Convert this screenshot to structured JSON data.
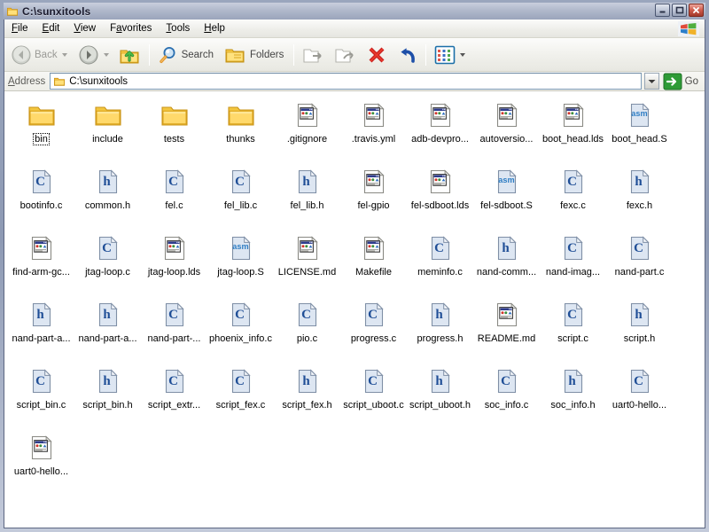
{
  "window": {
    "title": "C:\\sunxitools",
    "title_icon": "folder-icon",
    "buttons": {
      "minimize": "minimize-button",
      "maximize": "maximize-button",
      "close": "close-button"
    }
  },
  "menubar": {
    "items": [
      {
        "label": "File",
        "accel": "F"
      },
      {
        "label": "Edit",
        "accel": "E"
      },
      {
        "label": "View",
        "accel": "V"
      },
      {
        "label": "Favorites",
        "accel": "a"
      },
      {
        "label": "Tools",
        "accel": "T"
      },
      {
        "label": "Help",
        "accel": "H"
      }
    ],
    "brand_icon": "windows-flag-icon"
  },
  "toolbar": {
    "back_label": "Back",
    "forward_label": "",
    "up_label": "",
    "search_label": "Search",
    "folders_label": "Folders",
    "moveto_label": "",
    "copyto_label": "",
    "delete_label": "",
    "undo_label": "",
    "views_label": "",
    "icons": [
      "back-icon",
      "forward-icon",
      "up-folder-icon",
      "search-icon",
      "folders-icon",
      "move-to-icon",
      "copy-to-icon",
      "delete-icon",
      "undo-icon",
      "views-icon"
    ]
  },
  "address": {
    "label": "Address",
    "value": "C:\\sunxitools",
    "placeholder": "C:\\sunxitools",
    "folder_icon": "folder-icon",
    "dropdown_icon": "chevron-down-icon",
    "go_label": "Go",
    "go_icon": "go-arrow-icon"
  },
  "colors": {
    "folder_yellow": "#ffd96b",
    "folder_edge": "#d9a21b",
    "code_page": "#dde6f2",
    "code_letter": "#1f4e96",
    "asm_letter": "#2f7ec4",
    "delete_red": "#d02020",
    "undo_blue": "#1d4fa8",
    "go_green": "#2e9b36",
    "titlebar": "#9aa4bb",
    "pane_bg": "#ffffff"
  },
  "files": [
    {
      "name": "bin",
      "type": "folder",
      "icon": "folder-icon",
      "focused": true
    },
    {
      "name": "include",
      "type": "folder",
      "icon": "folder-icon",
      "focused": false
    },
    {
      "name": "tests",
      "type": "folder",
      "icon": "folder-icon",
      "focused": false
    },
    {
      "name": "thunks",
      "type": "folder",
      "icon": "folder-icon",
      "focused": false
    },
    {
      "name": ".gitignore",
      "type": "generic",
      "icon": "unknown-file-icon",
      "focused": false
    },
    {
      "name": ".travis.yml",
      "type": "generic",
      "icon": "unknown-file-icon",
      "focused": false
    },
    {
      "name": "adb-devpro...",
      "type": "generic",
      "icon": "unknown-file-icon",
      "focused": false
    },
    {
      "name": "autoversio...",
      "type": "generic",
      "icon": "unknown-file-icon",
      "focused": false
    },
    {
      "name": "boot_head.lds",
      "type": "generic",
      "icon": "unknown-file-icon",
      "focused": false
    },
    {
      "name": "boot_head.S",
      "type": "asm",
      "icon": "asm-file-icon",
      "focused": false
    },
    {
      "name": "bootinfo.c",
      "type": "c",
      "icon": "c-file-icon",
      "focused": false
    },
    {
      "name": "common.h",
      "type": "h",
      "icon": "h-file-icon",
      "focused": false
    },
    {
      "name": "fel.c",
      "type": "c",
      "icon": "c-file-icon",
      "focused": false
    },
    {
      "name": "fel_lib.c",
      "type": "c",
      "icon": "c-file-icon",
      "focused": false
    },
    {
      "name": "fel_lib.h",
      "type": "h",
      "icon": "h-file-icon",
      "focused": false
    },
    {
      "name": "fel-gpio",
      "type": "generic",
      "icon": "unknown-file-icon",
      "focused": false
    },
    {
      "name": "fel-sdboot.lds",
      "type": "generic",
      "icon": "unknown-file-icon",
      "focused": false
    },
    {
      "name": "fel-sdboot.S",
      "type": "asm",
      "icon": "asm-file-icon",
      "focused": false
    },
    {
      "name": "fexc.c",
      "type": "c",
      "icon": "c-file-icon",
      "focused": false
    },
    {
      "name": "fexc.h",
      "type": "h",
      "icon": "h-file-icon",
      "focused": false
    },
    {
      "name": "find-arm-gc...",
      "type": "generic",
      "icon": "unknown-file-icon",
      "focused": false
    },
    {
      "name": "jtag-loop.c",
      "type": "c",
      "icon": "c-file-icon",
      "focused": false
    },
    {
      "name": "jtag-loop.lds",
      "type": "generic",
      "icon": "unknown-file-icon",
      "focused": false
    },
    {
      "name": "jtag-loop.S",
      "type": "asm",
      "icon": "asm-file-icon",
      "focused": false
    },
    {
      "name": "LICENSE.md",
      "type": "generic",
      "icon": "unknown-file-icon",
      "focused": false
    },
    {
      "name": "Makefile",
      "type": "generic",
      "icon": "unknown-file-icon",
      "focused": false
    },
    {
      "name": "meminfo.c",
      "type": "c",
      "icon": "c-file-icon",
      "focused": false
    },
    {
      "name": "nand-comm...",
      "type": "h",
      "icon": "h-file-icon",
      "focused": false
    },
    {
      "name": "nand-imag...",
      "type": "c",
      "icon": "c-file-icon",
      "focused": false
    },
    {
      "name": "nand-part.c",
      "type": "c",
      "icon": "c-file-icon",
      "focused": false
    },
    {
      "name": "nand-part-a...",
      "type": "h",
      "icon": "h-file-icon",
      "focused": false
    },
    {
      "name": "nand-part-a...",
      "type": "h",
      "icon": "h-file-icon",
      "focused": false
    },
    {
      "name": "nand-part-...",
      "type": "c",
      "icon": "c-file-icon",
      "focused": false
    },
    {
      "name": "phoenix_info.c",
      "type": "c",
      "icon": "c-file-icon",
      "focused": false
    },
    {
      "name": "pio.c",
      "type": "c",
      "icon": "c-file-icon",
      "focused": false
    },
    {
      "name": "progress.c",
      "type": "c",
      "icon": "c-file-icon",
      "focused": false
    },
    {
      "name": "progress.h",
      "type": "h",
      "icon": "h-file-icon",
      "focused": false
    },
    {
      "name": "README.md",
      "type": "generic",
      "icon": "unknown-file-icon",
      "focused": false
    },
    {
      "name": "script.c",
      "type": "c",
      "icon": "c-file-icon",
      "focused": false
    },
    {
      "name": "script.h",
      "type": "h",
      "icon": "h-file-icon",
      "focused": false
    },
    {
      "name": "script_bin.c",
      "type": "c",
      "icon": "c-file-icon",
      "focused": false
    },
    {
      "name": "script_bin.h",
      "type": "h",
      "icon": "h-file-icon",
      "focused": false
    },
    {
      "name": "script_extr...",
      "type": "c",
      "icon": "c-file-icon",
      "focused": false
    },
    {
      "name": "script_fex.c",
      "type": "c",
      "icon": "c-file-icon",
      "focused": false
    },
    {
      "name": "script_fex.h",
      "type": "h",
      "icon": "h-file-icon",
      "focused": false
    },
    {
      "name": "script_uboot.c",
      "type": "c",
      "icon": "c-file-icon",
      "focused": false
    },
    {
      "name": "script_uboot.h",
      "type": "h",
      "icon": "h-file-icon",
      "focused": false
    },
    {
      "name": "soc_info.c",
      "type": "c",
      "icon": "c-file-icon",
      "focused": false
    },
    {
      "name": "soc_info.h",
      "type": "h",
      "icon": "h-file-icon",
      "focused": false
    },
    {
      "name": "uart0-hello...",
      "type": "c",
      "icon": "c-file-icon",
      "focused": false
    },
    {
      "name": "uart0-hello...",
      "type": "generic",
      "icon": "unknown-file-icon",
      "focused": false
    }
  ]
}
